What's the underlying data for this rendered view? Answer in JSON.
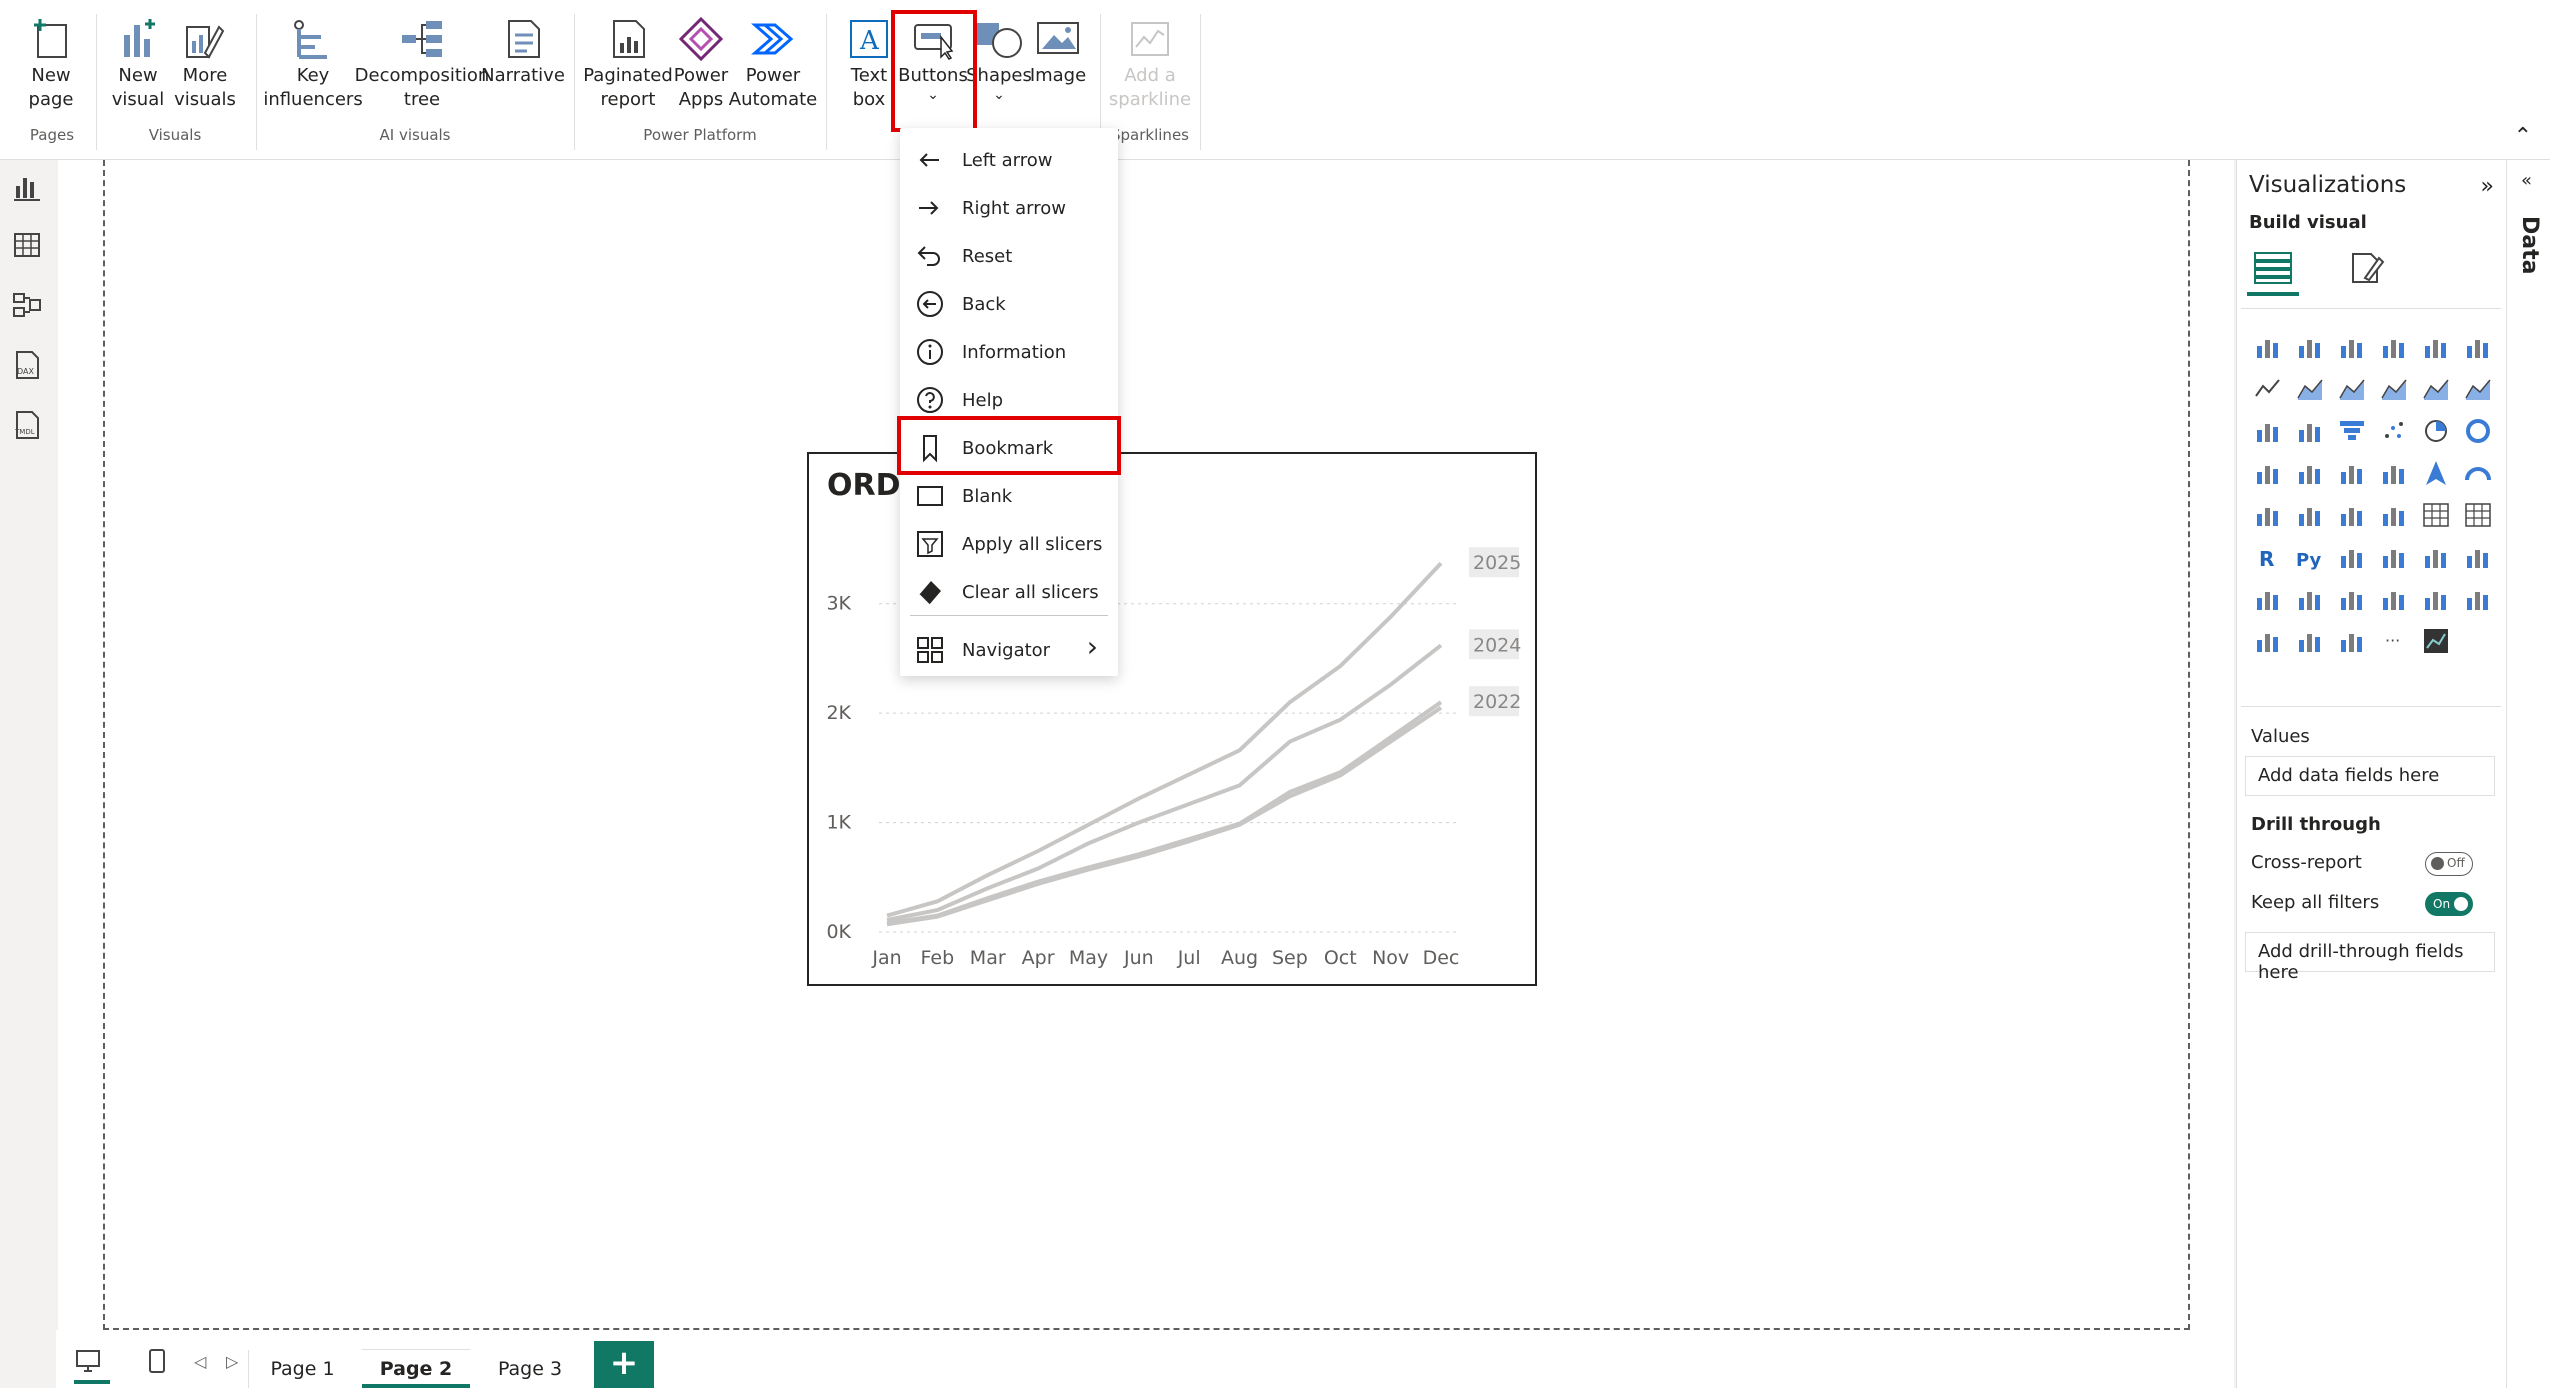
{
  "ribbon": {
    "groups": {
      "pages": "Pages",
      "visuals": "Visuals",
      "ai_visuals": "AI visuals",
      "power_platform": "Power Platform",
      "sparklines": "Sparklines"
    },
    "buttons": {
      "new_page": "New\npage",
      "new_visual": "New\nvisual",
      "more_visuals": "More\nvisuals",
      "key_influencers": "Key\ninfluencers",
      "decomposition_tree": "Decomposition\ntree",
      "narrative": "Narrative",
      "paginated_report": "Paginated\nreport",
      "power_apps": "Power\nApps",
      "power_automate": "Power\nAutomate",
      "text_box": "Text\nbox",
      "buttons": "Buttons",
      "shapes": "Shapes",
      "image": "Image",
      "add_sparkline": "Add a\nsparkline"
    }
  },
  "buttons_menu": {
    "items": [
      {
        "label": "Left arrow",
        "icon": "left-arrow-icon"
      },
      {
        "label": "Right arrow",
        "icon": "right-arrow-icon"
      },
      {
        "label": "Reset",
        "icon": "reset-icon"
      },
      {
        "label": "Back",
        "icon": "back-icon"
      },
      {
        "label": "Information",
        "icon": "information-icon"
      },
      {
        "label": "Help",
        "icon": "help-icon"
      },
      {
        "label": "Bookmark",
        "icon": "bookmark-icon"
      },
      {
        "label": "Blank",
        "icon": "blank-icon"
      },
      {
        "label": "Apply all slicers",
        "icon": "apply-slicers-icon"
      },
      {
        "label": "Clear all slicers",
        "icon": "clear-slicers-icon"
      },
      {
        "label": "Navigator",
        "icon": "navigator-icon"
      }
    ],
    "highlight_color": "#e00000"
  },
  "visual": {
    "title": "ORDE",
    "chart_data": {
      "type": "line",
      "categories": [
        "Jan",
        "Feb",
        "Mar",
        "Apr",
        "May",
        "Jun",
        "Jul",
        "Aug",
        "Sep",
        "Oct",
        "Nov",
        "Dec"
      ],
      "ylim": [
        0,
        3500
      ],
      "yticks": [
        "0K",
        "1K",
        "2K",
        "3K"
      ],
      "grid": true,
      "line_color": "#c8c6c4",
      "series": [
        {
          "name": "2025",
          "values": [
            150,
            280,
            520,
            740,
            980,
            1220,
            1440,
            1660,
            2100,
            2430,
            2880,
            3370
          ]
        },
        {
          "name": "2024",
          "values": [
            110,
            200,
            400,
            580,
            810,
            1000,
            1170,
            1340,
            1740,
            1940,
            2260,
            2620
          ]
        },
        {
          "name": "2022",
          "values": [
            80,
            150,
            310,
            460,
            590,
            710,
            850,
            990,
            1280,
            1460,
            1780,
            2100
          ]
        },
        {
          "name": "",
          "values": [
            70,
            140,
            290,
            440,
            570,
            690,
            830,
            980,
            1240,
            1430,
            1740,
            2050
          ]
        }
      ]
    }
  },
  "viz_pane": {
    "title": "Visualizations",
    "build_visual": "Build visual",
    "values_label": "Values",
    "values_placeholder": "Add data fields here",
    "drill_through": "Drill through",
    "cross_report": "Cross-report",
    "cross_report_state": "Off",
    "keep_all_filters": "Keep all filters",
    "keep_all_filters_state": "On",
    "drill_placeholder": "Add drill-through fields here",
    "accent": "#117865"
  },
  "data_pane": {
    "title": "Data"
  },
  "pages": {
    "tabs": [
      "Page 1",
      "Page 2",
      "Page 3"
    ],
    "active": "Page 2",
    "add": "+"
  }
}
